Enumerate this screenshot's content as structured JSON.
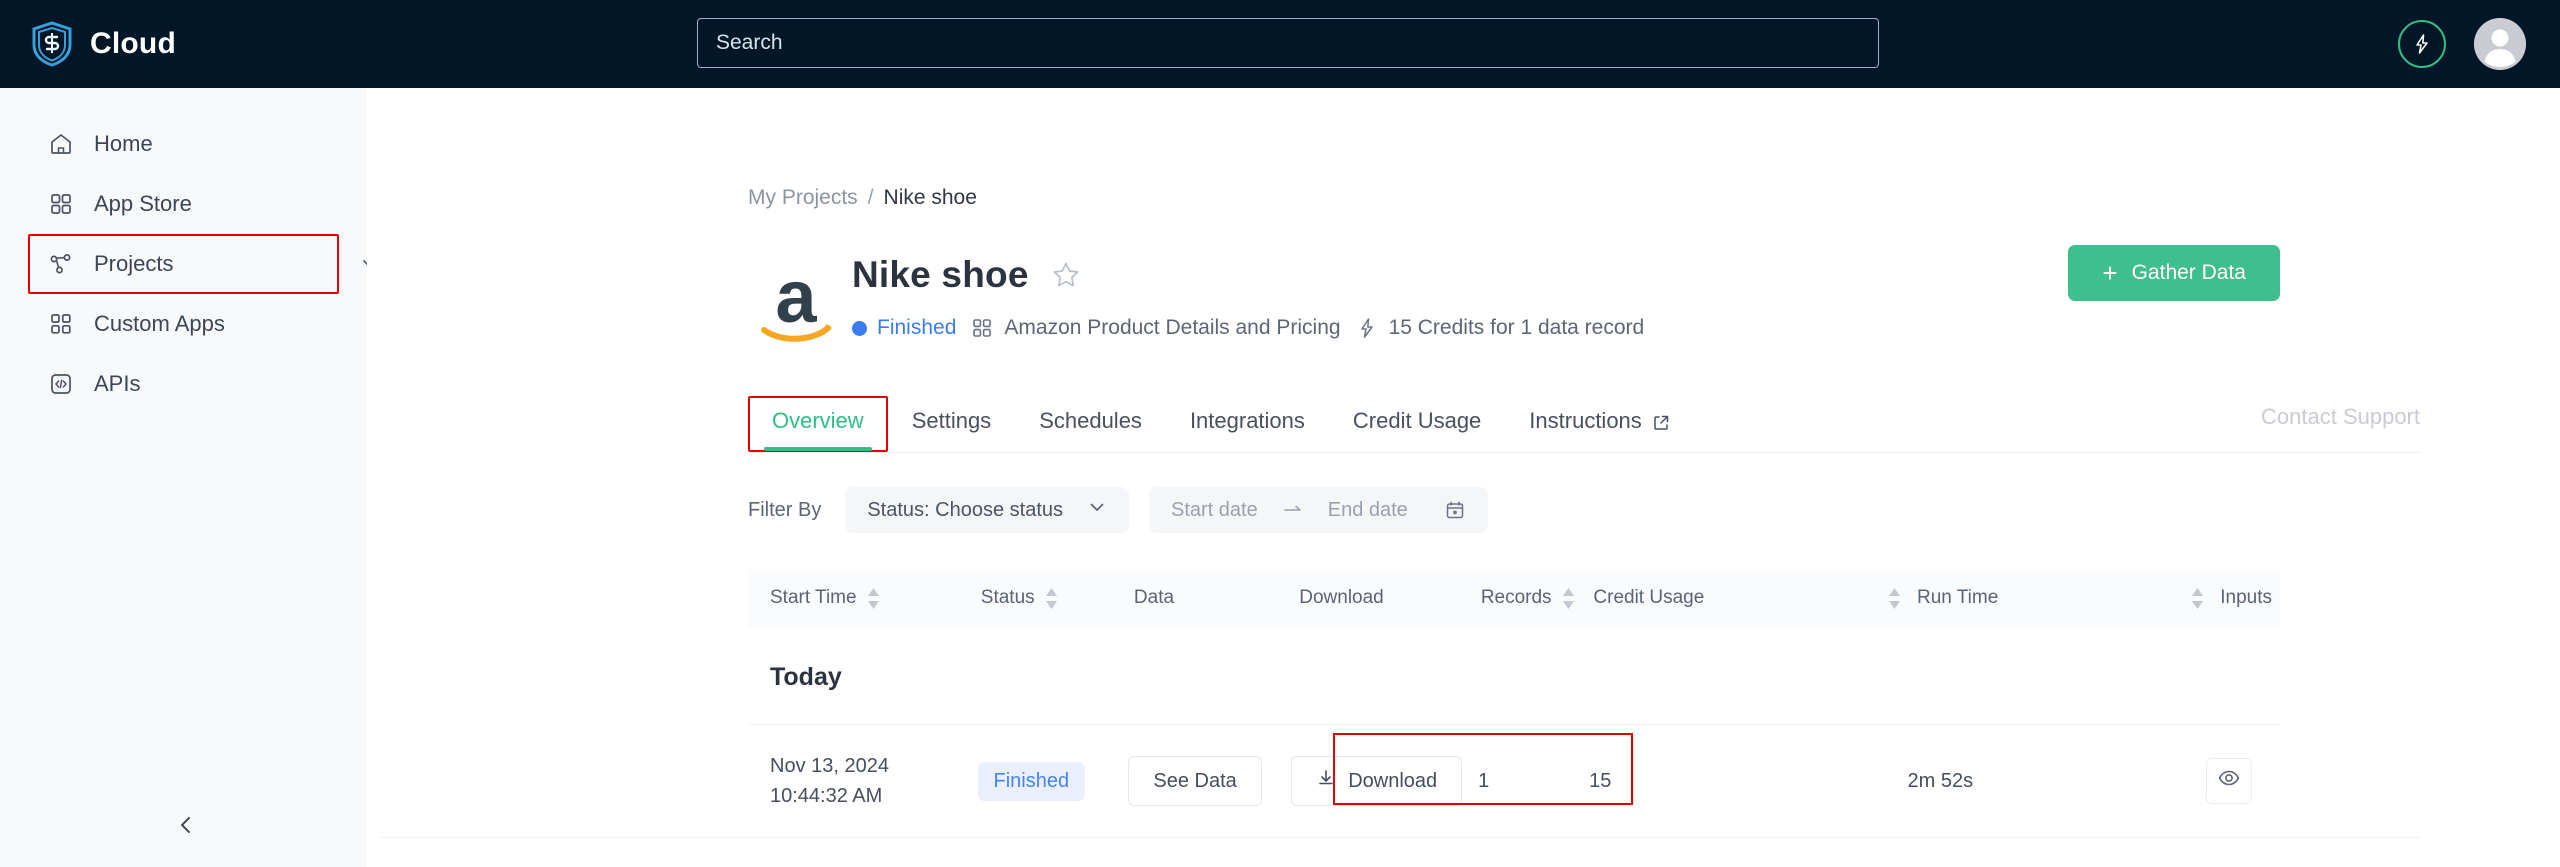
{
  "topbar": {
    "brand": "Cloud",
    "brand_logo_icon": "shield-s-logo",
    "search": {
      "placeholder": "Search",
      "value": ""
    },
    "credits_icon": "lightning-bolt-icon",
    "avatar_icon": "user-avatar-icon"
  },
  "sidebar": {
    "items": [
      {
        "label": "Home",
        "icon": "home-icon",
        "key": "home",
        "annotated": false,
        "chevron": false
      },
      {
        "label": "App Store",
        "icon": "grid-apps-icon",
        "key": "app-store",
        "annotated": false,
        "chevron": false
      },
      {
        "label": "Projects",
        "icon": "projects-node-icon",
        "key": "projects",
        "annotated": true,
        "chevron": true
      },
      {
        "label": "Custom Apps",
        "icon": "custom-apps-icon",
        "key": "custom-apps",
        "annotated": false,
        "chevron": false
      },
      {
        "label": "APIs",
        "icon": "code-brackets-icon",
        "key": "apis",
        "annotated": false,
        "chevron": false
      }
    ],
    "collapse_icon": "chevron-left-icon"
  },
  "breadcrumb": {
    "parent": "My Projects",
    "separator": "/",
    "current": "Nike shoe"
  },
  "hero": {
    "logo_icon": "amazon-logo",
    "title": "Nike shoe",
    "star_icon": "star-outline-icon",
    "status": "Finished",
    "status_color": "#3d7bf0",
    "template": "Amazon Product Details and Pricing",
    "template_icon": "grid-apps-icon",
    "credits_note": "15 Credits for 1 data record",
    "credits_icon": "lightning-bolt-icon",
    "gather_button": {
      "label": "Gather Data",
      "plus": "+",
      "color": "#3fbf8f"
    }
  },
  "tabs": {
    "items": [
      {
        "label": "Overview",
        "key": "overview",
        "active": true,
        "annotated": true,
        "external": false
      },
      {
        "label": "Settings",
        "key": "settings",
        "active": false,
        "annotated": false,
        "external": false
      },
      {
        "label": "Schedules",
        "key": "schedules",
        "active": false,
        "annotated": false,
        "external": false
      },
      {
        "label": "Integrations",
        "key": "integrations",
        "active": false,
        "annotated": false,
        "external": false
      },
      {
        "label": "Credit Usage",
        "key": "credit-usage",
        "active": false,
        "annotated": false,
        "external": false
      },
      {
        "label": "Instructions",
        "key": "instructions",
        "active": false,
        "annotated": false,
        "external": true
      }
    ],
    "contact_support": "Contact Support",
    "active_color": "#2fbf84"
  },
  "filter": {
    "label": "Filter By",
    "status_select": {
      "text": "Status: Choose status",
      "icon": "chevron-down-icon"
    },
    "start_date_placeholder": "Start date",
    "range_arrow_icon": "arrow-right-icon",
    "end_date_placeholder": "End date",
    "calendar_icon": "calendar-icon"
  },
  "table": {
    "columns": [
      {
        "label": "Start Time",
        "sortable": true,
        "key": "start-time"
      },
      {
        "label": "Status",
        "sortable": true,
        "key": "status"
      },
      {
        "label": "Data",
        "sortable": false,
        "key": "data"
      },
      {
        "label": "Download",
        "sortable": false,
        "key": "download"
      },
      {
        "label": "Records",
        "sortable": true,
        "key": "records"
      },
      {
        "label": "Credit Usage",
        "sortable": true,
        "key": "credit-usage"
      },
      {
        "label": "Run Time",
        "sortable": true,
        "key": "run-time"
      },
      {
        "label": "Inputs",
        "sortable": false,
        "key": "inputs"
      }
    ],
    "group_label": "Today",
    "rows": [
      {
        "start_time": "Nov 13, 2024 10:44:32 AM",
        "status": "Finished",
        "see_data_label": "See Data",
        "download_label": "Download",
        "download_icon": "download-icon",
        "records": "1",
        "credit_usage": "15",
        "run_time": "2m 52s",
        "inputs_icon": "eye-icon"
      }
    ]
  },
  "annotations": {
    "highlight_color": "#e60000"
  }
}
